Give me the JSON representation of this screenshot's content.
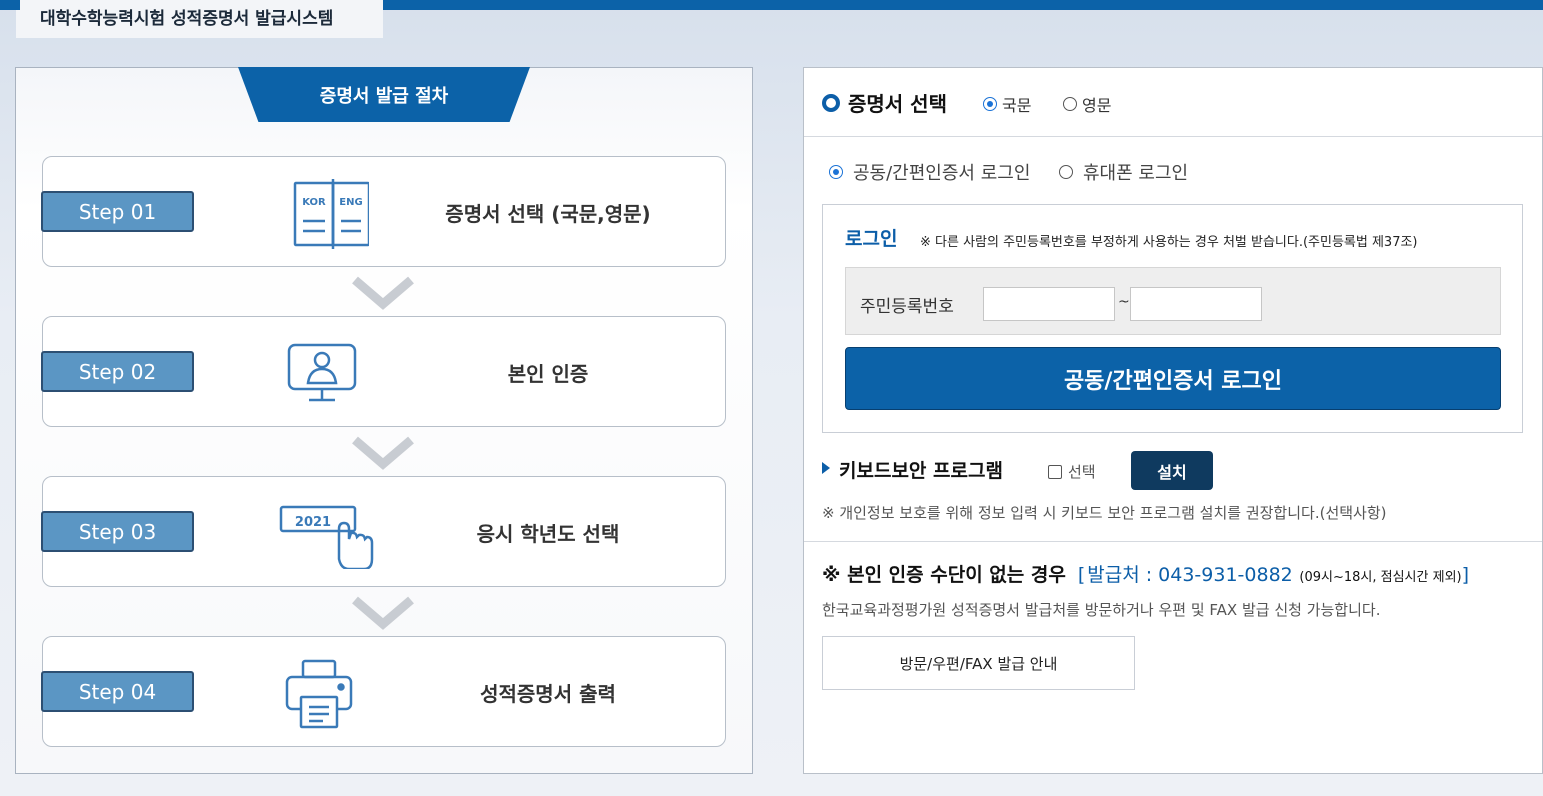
{
  "app": {
    "title": "대학수학능력시험 성적증명서 발급시스템"
  },
  "procedure": {
    "title": "증명서 발급 절차",
    "steps": [
      {
        "badge": "Step 01",
        "label": "증명서 선택 (국문,영문)",
        "icon": "book-kor-eng-icon",
        "icon_text_left": "KOR",
        "icon_text_right": "ENG"
      },
      {
        "badge": "Step 02",
        "label": "본인 인증",
        "icon": "monitor-user-icon"
      },
      {
        "badge": "Step 03",
        "label": "응시 학년도 선택",
        "icon": "hand-click-icon",
        "icon_text": "2021"
      },
      {
        "badge": "Step 04",
        "label": "성적증명서 출력",
        "icon": "printer-icon"
      }
    ]
  },
  "certificate": {
    "title": "증명서 선택",
    "languages": [
      {
        "label": "국문",
        "selected": true
      },
      {
        "label": "영문",
        "selected": false
      }
    ]
  },
  "login_types": [
    {
      "label": "공동/간편인증서 로그인",
      "selected": true
    },
    {
      "label": "휴대폰 로그인",
      "selected": false
    }
  ],
  "login": {
    "title": "로그인",
    "notice": "※ 다른 사람의 주민등록번호를 부정하게 사용하는 경우 처벌 받습니다.(주민등록법 제37조)",
    "rrn_label": "주민등록번호",
    "rrn_front_value": "",
    "rrn_back_value": "",
    "separator": "~",
    "button_label": "공동/간편인증서 로그인"
  },
  "keyboard_security": {
    "title": "키보드보안 프로그램",
    "checkbox_label": "선택",
    "checked": false,
    "install_label": "설치",
    "note": "※ 개인정보 보호를 위해 정보 입력 시 키보드 보안 프로그램 설치를 권장합니다.(선택사항)"
  },
  "no_auth": {
    "title": "※ 본인 인증 수단이 없는 경우",
    "bracket_open": "[",
    "contact": "발급처 : 043-931-0882",
    "hours": "(09시~18시, 점심시간 제외)",
    "bracket_close": "]",
    "description": "한국교육과정평가원 성적증명서 발급처를 방문하거나 우편 및 FAX 발급 신청 가능합니다.",
    "button_label": "방문/우편/FAX 발급 안내"
  },
  "colors": {
    "primary": "#0c62a8",
    "badge": "#5b96c4",
    "install": "#0f3a5f",
    "icon": "#3a7ab8",
    "chevron": "#c8ccd2"
  }
}
